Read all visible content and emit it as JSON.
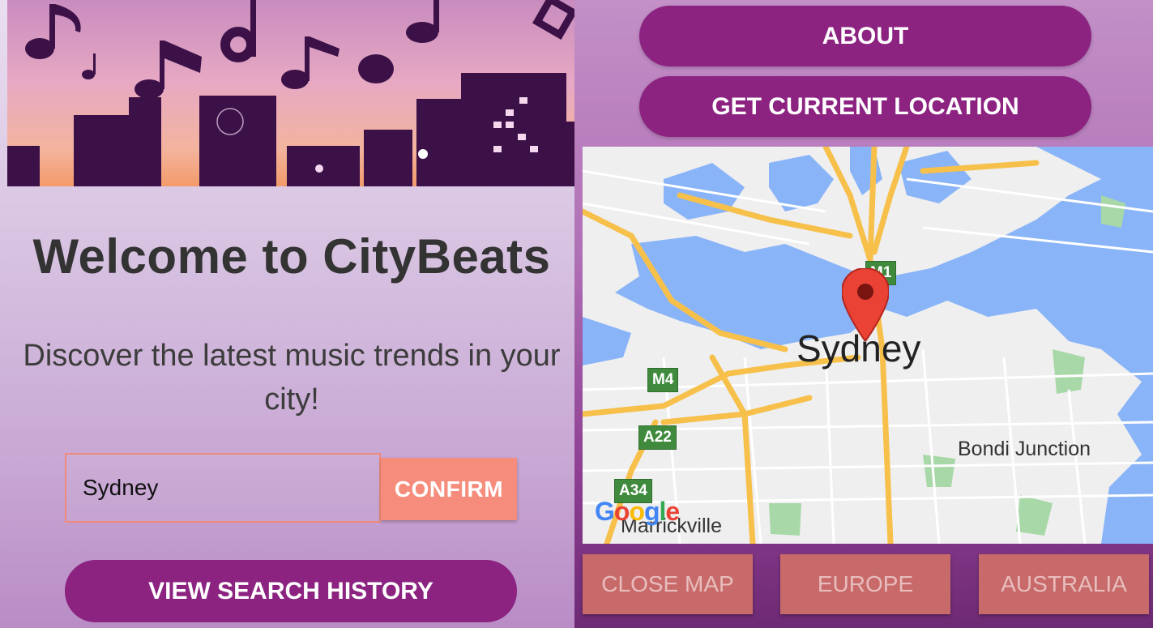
{
  "home": {
    "title": "Welcome to CityBeats",
    "tagline": "Discover the latest music trends in your city!",
    "city_input_value": "Sydney",
    "confirm_label": "CONFIRM",
    "history_label": "VIEW SEARCH HISTORY"
  },
  "map_screen": {
    "about_label": "ABOUT",
    "location_label": "GET CURRENT LOCATION",
    "map": {
      "city_label": "Sydney",
      "suburb_labels": [
        "Bondi Junction",
        "Marrickville"
      ],
      "road_shields": [
        "M1",
        "M4",
        "A22",
        "A34"
      ],
      "attribution": "Google"
    },
    "buttons": {
      "close_map": "CLOSE MAP",
      "europe": "EUROPE",
      "australia": "AUSTRALIA"
    }
  },
  "colors": {
    "accent_purple": "#8c2381",
    "confirm_salmon": "#f58c7c",
    "region_button": "#c96a6a",
    "map_water": "#8ab4f8",
    "map_road": "#f6c04a",
    "pin_red": "#ea4335"
  }
}
